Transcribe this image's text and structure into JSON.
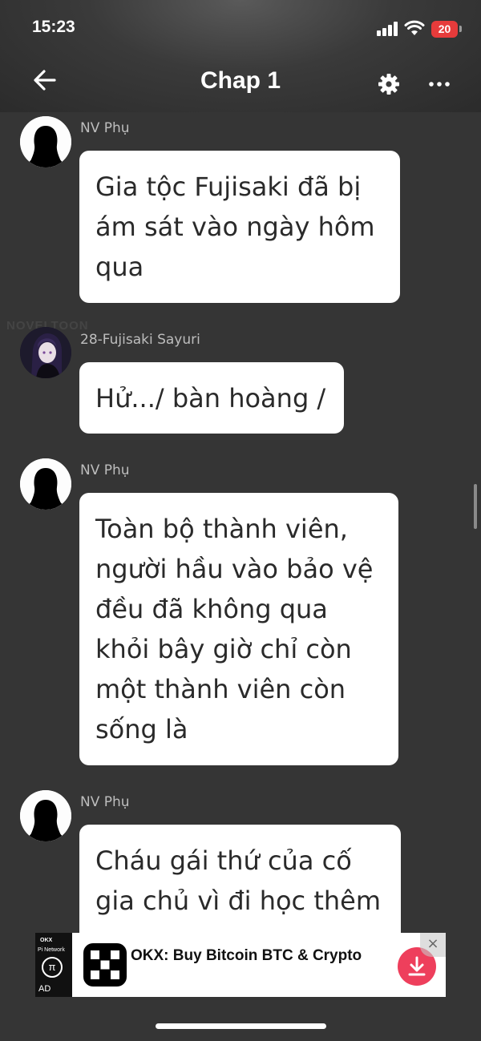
{
  "status_bar": {
    "time": "15:23",
    "battery_level": "20",
    "battery_color": "#e63b3b"
  },
  "header": {
    "title": "Chap 1",
    "back_icon": "arrow-left-icon",
    "settings_icon": "gear-icon",
    "more_icon": "more-horizontal-icon"
  },
  "watermark": "NOVELTOON",
  "messages": [
    {
      "sender": "NV Phụ",
      "avatar": "silhouette",
      "lines": [
        "Gia tộc Fujisaki đã bị",
        "ám sát vào ngày hôm",
        "qua"
      ]
    },
    {
      "sender": "28-Fujisaki Sayuri",
      "avatar": "anime-girl",
      "lines": [
        "Hử.../ bàn hoàng /"
      ]
    },
    {
      "sender": "NV Phụ",
      "avatar": "silhouette",
      "lines": [
        "Toàn bộ thành viên,",
        "người hầu vào bảo vệ",
        "đều đã không qua",
        "khỏi bây giờ chỉ còn",
        "một thành viên còn",
        "sống là"
      ]
    },
    {
      "sender": "NV Phụ",
      "avatar": "silhouette",
      "lines": [
        "Cháu gái thứ của cố",
        "gia chủ vì đi học thêm"
      ]
    }
  ],
  "ad": {
    "title": "OKX: Buy Bitcoin BTC & Crypto",
    "thumb_brand": "OKX",
    "thumb_text": "Pi Network",
    "thumb_symbol": "π",
    "badge": "AD",
    "close_label": "×",
    "download_color": "#ee3f5c"
  }
}
